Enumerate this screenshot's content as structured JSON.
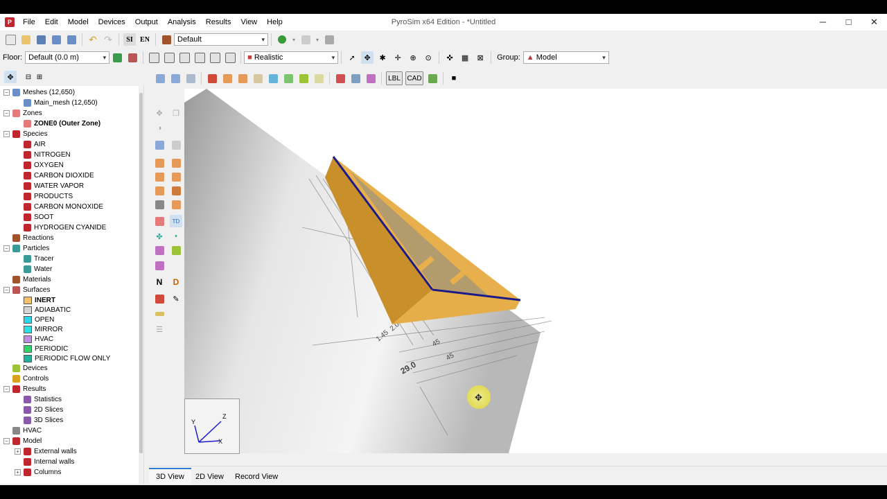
{
  "app": {
    "title": "PyroSim x64 Edition - *Untitled",
    "logo": "P"
  },
  "menu": [
    "File",
    "Edit",
    "Model",
    "Devices",
    "Output",
    "Analysis",
    "Results",
    "View",
    "Help"
  ],
  "window_controls": {
    "minimize": "─",
    "maximize": "□",
    "close": "✕"
  },
  "toolbar1": {
    "units_si": "SI",
    "units_en": "EN",
    "view_combo": "Default"
  },
  "toolbar2": {
    "floor_label": "Floor:",
    "floor_value": "Default (0.0 m)",
    "render_mode": "Realistic",
    "group_label": "Group:",
    "group_value": "Model"
  },
  "toolbar3": {
    "lbl_button": "LBL",
    "cad_button": "CAD"
  },
  "vtool": {
    "n_button": "N",
    "d_button": "D"
  },
  "tree": {
    "meshes": "Meshes (12,650)",
    "main_mesh": "Main_mesh (12,650)",
    "zones": "Zones",
    "zone0": "ZONE0 (Outer Zone)",
    "species": "Species",
    "species_items": [
      "AIR",
      "NITROGEN",
      "OXYGEN",
      "CARBON DIOXIDE",
      "WATER VAPOR",
      "PRODUCTS",
      "CARBON MONOXIDE",
      "SOOT",
      "HYDROGEN CYANIDE"
    ],
    "reactions": "Reactions",
    "particles": "Particles",
    "particle_items": [
      "Tracer",
      "Water"
    ],
    "materials": "Materials",
    "surfaces": "Surfaces",
    "surface_items": [
      {
        "label": "INERT",
        "color": "#f5c26b"
      },
      {
        "label": "ADIABATIC",
        "color": "#d4d4d4"
      },
      {
        "label": "OPEN",
        "color": "#2fd5e8"
      },
      {
        "label": "MIRROR",
        "color": "#2fe0e0"
      },
      {
        "label": "HVAC",
        "color": "#c08ce0"
      },
      {
        "label": "PERIODIC",
        "color": "#2fd36a"
      },
      {
        "label": "PERIODIC FLOW ONLY",
        "color": "#1fb3a0"
      }
    ],
    "devices": "Devices",
    "controls": "Controls",
    "results": "Results",
    "result_items": [
      "Statistics",
      "2D Slices",
      "3D Slices"
    ],
    "hvac": "HVAC",
    "model": "Model",
    "model_items": [
      "External walls",
      "Internal walls",
      "Columns"
    ]
  },
  "axes": {
    "x": "X",
    "y": "Y",
    "z": "Z"
  },
  "drawing_labels": [
    "1.45",
    "2.0",
    "45",
    "45",
    "29.0"
  ],
  "tabs": [
    "3D View",
    "2D View",
    "Record View"
  ],
  "colors": {
    "wall": "#e8b04c",
    "wall_dark": "#c98f2a",
    "edge": "#1a1a8a",
    "cursor": "#f3ee8a"
  }
}
